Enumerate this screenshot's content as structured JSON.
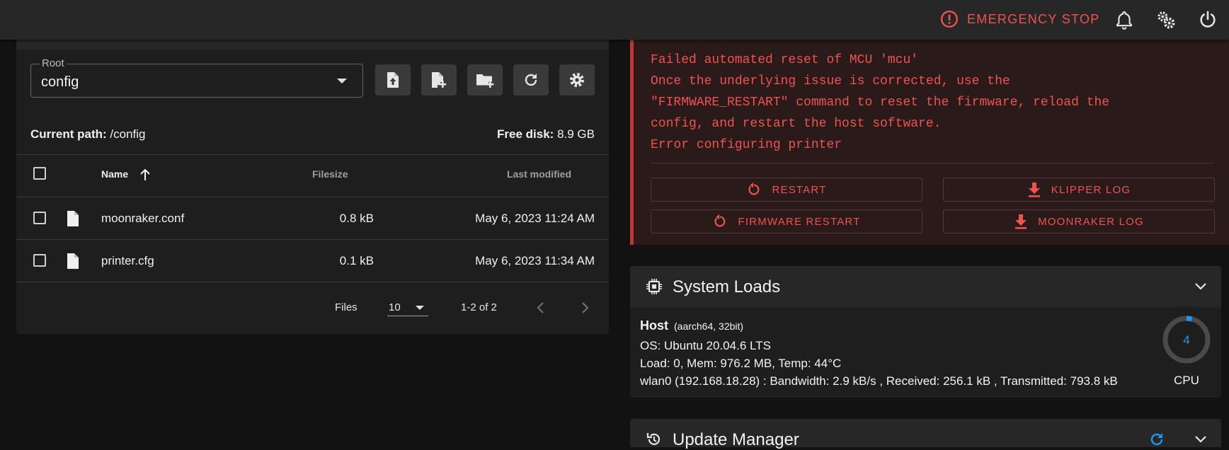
{
  "topbar": {
    "emergency_stop_label": "EMERGENCY STOP",
    "accent_color": "#ef5350"
  },
  "file_browser": {
    "root": {
      "label": "Root",
      "value": "config"
    },
    "toolbar_icons": [
      "file-upload-icon",
      "file-plus-icon",
      "folder-plus-icon",
      "refresh-icon",
      "settings-icon"
    ],
    "current_path_label": "Current path:",
    "current_path": "/config",
    "free_disk_label": "Free disk:",
    "free_disk": "8.9 GB",
    "columns": {
      "name": "Name",
      "filesize": "Filesize",
      "modified": "Last modified"
    },
    "sort": {
      "column": "Name",
      "direction": "ascending",
      "icon": "arrow-up-icon"
    },
    "files": [
      {
        "name": "moonraker.conf",
        "size": "0.8 kB",
        "modified": "May 6, 2023 11:24 AM"
      },
      {
        "name": "printer.cfg",
        "size": "0.1 kB",
        "modified": "May 6, 2023 11:34 AM"
      }
    ],
    "footer": {
      "per_page_label": "Files",
      "per_page": "10",
      "range": "1-2 of 2"
    }
  },
  "error_panel": {
    "lines": [
      "Failed automated reset of MCU 'mcu'",
      "Once the underlying issue is corrected, use the",
      "\"FIRMWARE_RESTART\" command to reset the firmware, reload the",
      "config, and restart the host software.",
      "Error configuring printer"
    ],
    "buttons": {
      "restart": "RESTART",
      "klipper_log": "KLIPPER LOG",
      "firmware_restart": "FIRMWARE RESTART",
      "moonraker_log": "MOONRAKER LOG"
    },
    "color": "#ef5350"
  },
  "system_loads": {
    "title": "System Loads",
    "host_label": "Host",
    "host_arch": "(aarch64, 32bit)",
    "os": "OS: Ubuntu 20.04.6 LTS",
    "load": "Load: 0, Mem: 976.2 MB, Temp: 44°C",
    "network": "wlan0 (192.168.18.28) : Bandwidth: 2.9 kB/s , Received: 256.1 kB , Transmitted: 793.8 kB",
    "cpu_value": "4",
    "cpu_percent": 4,
    "cpu_label": "CPU",
    "gauge_color": "#2196f3"
  },
  "update_manager": {
    "title": "Update Manager"
  }
}
